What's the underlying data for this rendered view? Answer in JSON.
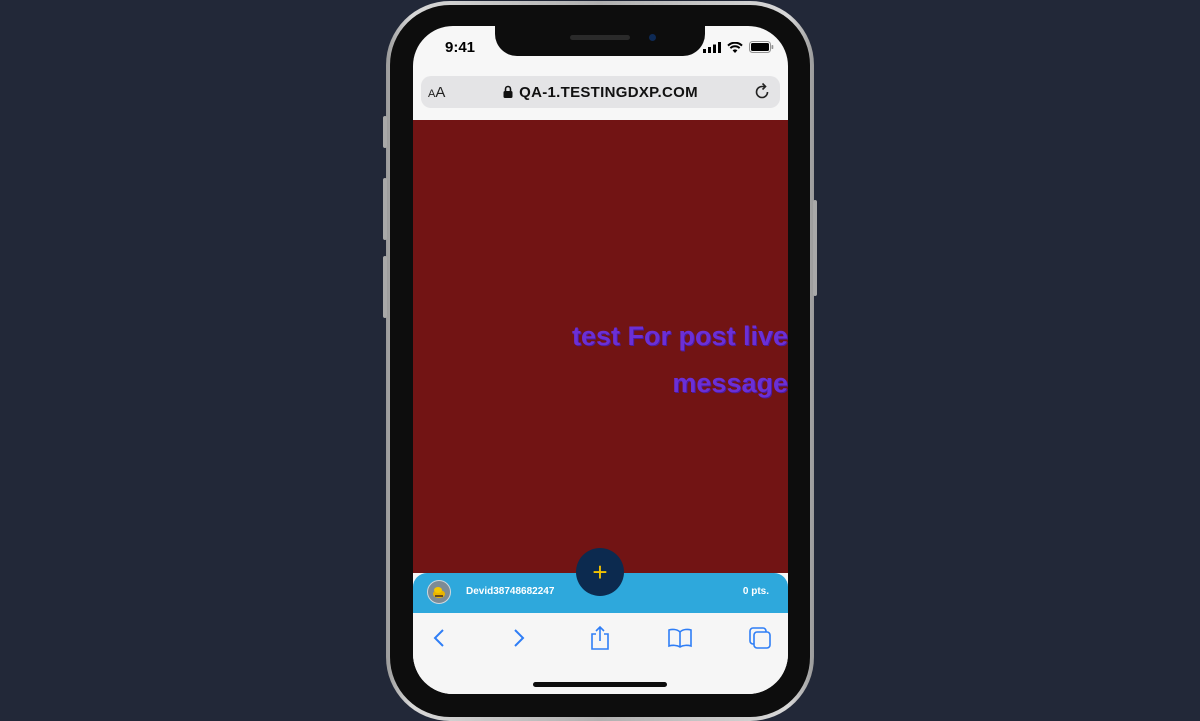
{
  "status": {
    "time": "9:41"
  },
  "browser": {
    "text_size_small": "A",
    "text_size_large": "A",
    "url": "QA-1.TESTINGDXP.COM"
  },
  "content": {
    "message_line1": "test For post live",
    "message_line2": "message",
    "background_color": "#721414",
    "message_color": "#6b2fd6"
  },
  "bottom_bar": {
    "username": "Devid38748682247",
    "points": "0 pts.",
    "accent_color": "#2ea8dc"
  },
  "fab": {
    "symbol": "+",
    "color": "#0c2a4f"
  },
  "toolbar": {
    "icons": [
      "back-icon",
      "forward-icon",
      "share-icon",
      "bookmarks-icon",
      "tabs-icon"
    ]
  }
}
